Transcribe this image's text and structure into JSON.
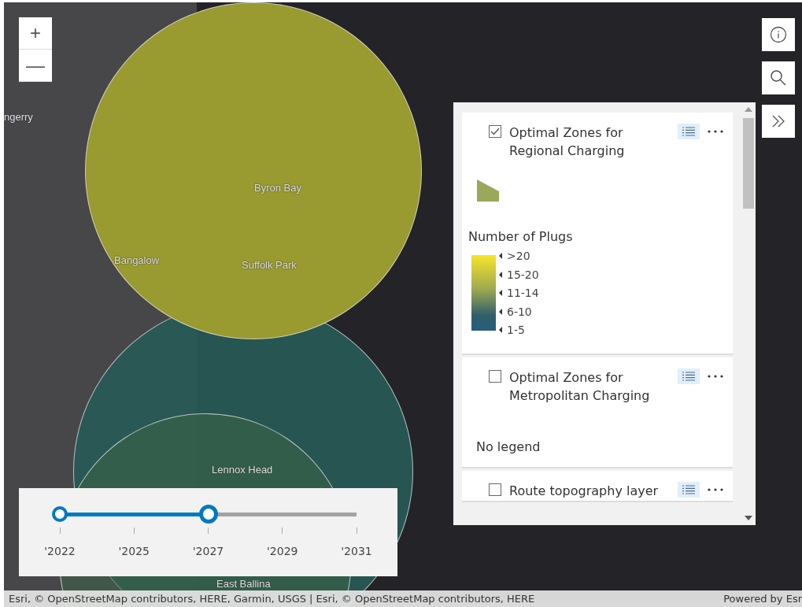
{
  "map": {
    "zoom_buttons": [
      {
        "label": "+"
      },
      {
        "label": "—"
      }
    ],
    "place_labels": [
      "ngerry",
      "Byron Bay",
      "Bangalow",
      "Suffolk Park",
      "Lennox Head",
      "East Ballina"
    ],
    "attribution": "Esri, © OpenStreetMap contributors, HERE, Garmin, USGS | Esri, © OpenStreetMap contributors, HERE",
    "powered_by": "Powered by Esr"
  },
  "time_slider": {
    "thumbs": [
      {
        "level": 0
      },
      {
        "level": 0.5
      }
    ],
    "ticks": [
      "'2022",
      "'2025",
      "'2027",
      "'2029",
      "'2031"
    ]
  },
  "layer_list": {
    "layers": [
      {
        "title": "Optimal Zones for Regional Charging",
        "checked": true,
        "kind": "ramp",
        "legend_title": "Number of Plugs",
        "stops": [
          ">20",
          "15-20",
          "11-14",
          "6-10",
          "1-5"
        ]
      },
      {
        "title": "Optimal Zones for Metropolitan Charging",
        "checked": false,
        "kind": "none",
        "note": "No legend"
      },
      {
        "title": "Route topography layer",
        "checked": false,
        "kind": "cut"
      }
    ]
  }
}
